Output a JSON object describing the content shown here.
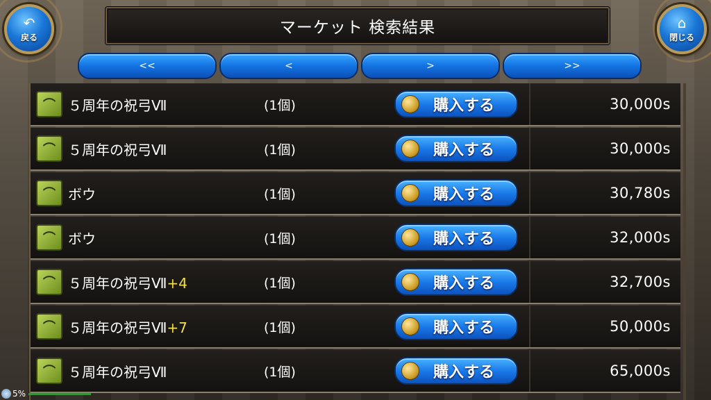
{
  "header": {
    "title": "マーケット 検索結果"
  },
  "nav": {
    "back_label": "戻る",
    "back_icon": "back-arrow-icon",
    "close_label": "閉じる",
    "close_icon": "home-icon"
  },
  "pager": {
    "first_label": "<<",
    "prev_label": "<",
    "next_label": ">",
    "last_label": ">>"
  },
  "items": [
    {
      "name": "５周年の祝弓Ⅶ",
      "plus": "",
      "qty": "(1個)",
      "buy": "購入する",
      "price": "30,000s"
    },
    {
      "name": "５周年の祝弓Ⅶ",
      "plus": "",
      "qty": "(1個)",
      "buy": "購入する",
      "price": "30,000s"
    },
    {
      "name": "ボウ",
      "plus": "",
      "qty": "(1個)",
      "buy": "購入する",
      "price": "30,780s"
    },
    {
      "name": "ボウ",
      "plus": "",
      "qty": "(1個)",
      "buy": "購入する",
      "price": "32,000s"
    },
    {
      "name": "５周年の祝弓Ⅶ",
      "plus": "+4",
      "qty": "(1個)",
      "buy": "購入する",
      "price": "32,700s"
    },
    {
      "name": "５周年の祝弓Ⅶ",
      "plus": "+7",
      "qty": "(1個)",
      "buy": "購入する",
      "price": "50,000s"
    },
    {
      "name": "５周年の祝弓Ⅶ",
      "plus": "",
      "qty": "(1個)",
      "buy": "購入する",
      "price": "65,000s"
    }
  ],
  "status": {
    "battery": "5%"
  },
  "colors": {
    "accent": "#1a7ae8",
    "plus": "#f3e14b",
    "frame": "#b69a5e"
  }
}
